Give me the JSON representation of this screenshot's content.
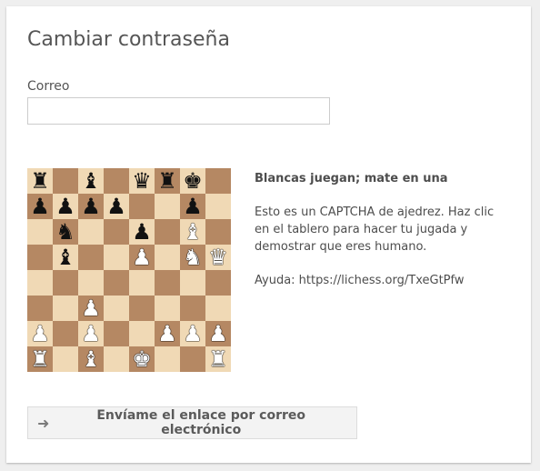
{
  "form": {
    "title": "Cambiar contraseña",
    "email_label": "Correo",
    "email_value": "",
    "submit_label": "Envíame el enlace por correo electrónico",
    "submit_icon": "sign-in-icon"
  },
  "captcha": {
    "heading": "Blancas juegan; mate en una",
    "description": "Esto es un CAPTCHA de ajedrez. Haz clic en el tablero para hacer tu jugada y demostrar que eres humano.",
    "help": "Ayuda: https://lichess.org/TxeGtPfw",
    "board": [
      [
        "bR",
        "",
        "bB",
        "",
        "bQ",
        "bR",
        "bK",
        ""
      ],
      [
        "bP",
        "bP",
        "bP",
        "bP",
        "",
        "",
        "bP",
        ""
      ],
      [
        "",
        "bN",
        "",
        "",
        "bP",
        "",
        "wB",
        ""
      ],
      [
        "",
        "bB",
        "",
        "",
        "wP",
        "",
        "wN",
        "wQ"
      ],
      [
        "",
        "",
        "",
        "",
        "",
        "",
        "",
        ""
      ],
      [
        "",
        "",
        "wP",
        "",
        "",
        "",
        "",
        ""
      ],
      [
        "wP",
        "",
        "wP",
        "",
        "",
        "wP",
        "wP",
        "wP"
      ],
      [
        "wR",
        "",
        "wB",
        "",
        "wK",
        "",
        "",
        "wR"
      ]
    ]
  },
  "colors": {
    "light_square": "#f0d9b5",
    "dark_square": "#b58863"
  }
}
